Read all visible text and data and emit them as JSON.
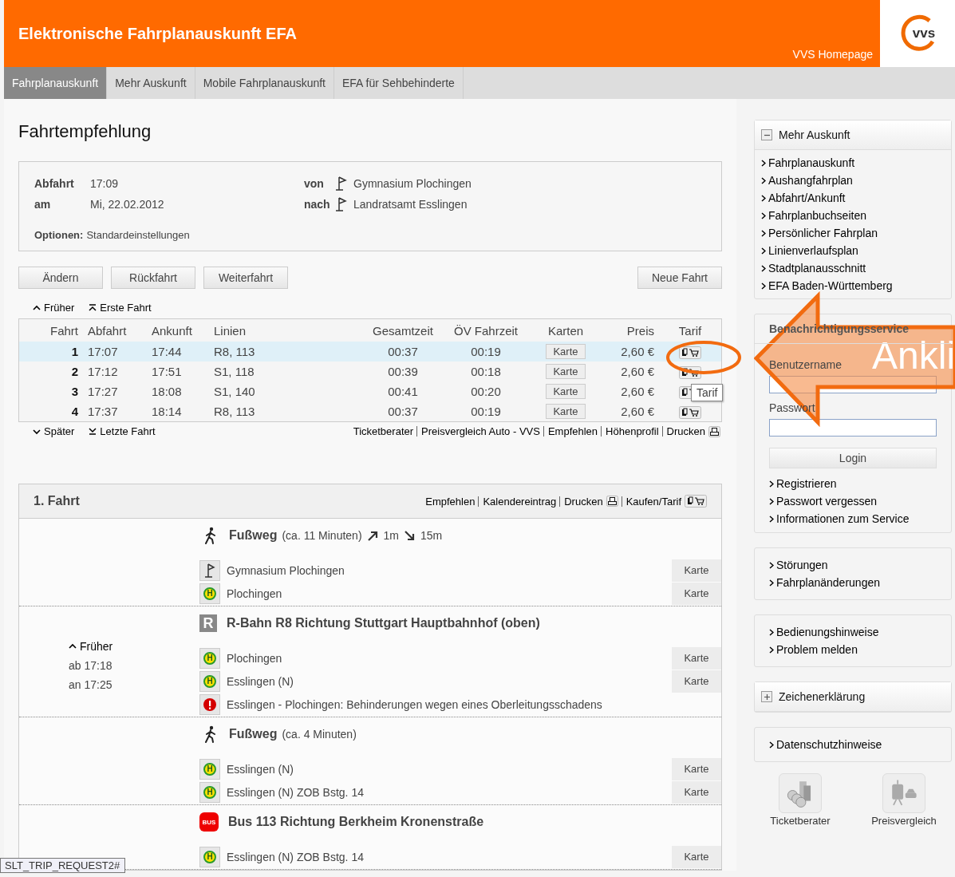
{
  "header": {
    "title": "Elektronische Fahrplanauskunft EFA",
    "link": "VVS Homepage",
    "logo": "vvs"
  },
  "nav": [
    {
      "label": "Fahrplanauskunft",
      "selected": true
    },
    {
      "label": "Mehr Auskunft",
      "selected": false
    },
    {
      "label": "Mobile Fahrplanauskunft",
      "selected": false
    },
    {
      "label": "EFA für Sehbehinderte",
      "selected": false
    }
  ],
  "page_title": "Fahrtempfehlung",
  "summary": {
    "times": [
      {
        "label": "Abfahrt",
        "value": "17:09"
      },
      {
        "label": "am",
        "value": "Mi, 22.02.2012"
      }
    ],
    "stops": [
      {
        "label": "von",
        "value": "Gymnasium Plochingen"
      },
      {
        "label": "nach",
        "value": "Landratsamt Esslingen"
      }
    ],
    "options_label": "Optionen:",
    "options_value": "Standardeinstellungen"
  },
  "actions": [
    "Ändern",
    "Rückfahrt",
    "Weiterfahrt"
  ],
  "new_trip": "Neue Fahrt",
  "earlier": [
    {
      "kind": "step",
      "label": "Früher"
    },
    {
      "kind": "jump",
      "label": "Erste Fahrt"
    }
  ],
  "results": {
    "columns": [
      "Fahrt",
      "Abfahrt",
      "Ankunft",
      "Linien",
      "Gesamtzeit",
      "ÖV Fahrzeit",
      "Karten",
      "Preis",
      "Tarif"
    ],
    "rows": [
      {
        "num": "1",
        "dep": "17:07",
        "arr": "17:44",
        "lines": "R8, 113",
        "total": "00:37",
        "pt": "00:19",
        "map": "Karte",
        "price": "2,60 €",
        "selected": true
      },
      {
        "num": "2",
        "dep": "17:12",
        "arr": "17:51",
        "lines": "S1, 118",
        "total": "00:39",
        "pt": "00:18",
        "map": "Karte",
        "price": "2,60 €",
        "selected": false
      },
      {
        "num": "3",
        "dep": "17:27",
        "arr": "18:08",
        "lines": "S1, 140",
        "total": "00:41",
        "pt": "00:20",
        "map": "Karte",
        "price": "2,60 €",
        "selected": false
      },
      {
        "num": "4",
        "dep": "17:37",
        "arr": "18:14",
        "lines": "R8, 113",
        "total": "00:37",
        "pt": "00:19",
        "map": "Karte",
        "price": "2,60 €",
        "selected": false
      }
    ]
  },
  "later": [
    {
      "kind": "step",
      "label": "Später"
    },
    {
      "kind": "jump",
      "label": "Letzte Fahrt"
    }
  ],
  "footer_links": [
    {
      "kind": "text",
      "label": "Ticketberater"
    },
    {
      "kind": "text",
      "label": "Preisvergleich Auto - VVS"
    },
    {
      "kind": "text",
      "label": "Empfehlen"
    },
    {
      "kind": "text",
      "label": "Höhenprofil"
    },
    {
      "kind": "print",
      "label": "Drucken"
    }
  ],
  "trip": {
    "title": "1. Fahrt",
    "links": [
      {
        "kind": "text",
        "label": "Empfehlen"
      },
      {
        "kind": "text",
        "label": "Kalendereintrag"
      },
      {
        "kind": "print",
        "label": "Drucken"
      },
      {
        "kind": "ticket",
        "label": "Kaufen/Tarif"
      }
    ],
    "legs": [
      {
        "kind": "walk",
        "title": "Fußweg",
        "note": "(ca. 11 Minuten)",
        "up": "1m",
        "down": "15m",
        "stops": [
          {
            "kind": "flag",
            "name": "Gymnasium Plochingen",
            "map": "Karte"
          },
          {
            "kind": "stop",
            "symbol": "H",
            "name": "Plochingen",
            "map": "Karte"
          }
        ]
      },
      {
        "kind": "rail",
        "badge": "R",
        "title": "R-Bahn R8 Richtung Stuttgart Hauptbahnhof (oben)",
        "earlier": "Früher",
        "times": [
          "ab 17:18",
          "an 17:25"
        ],
        "stops": [
          {
            "kind": "stop",
            "symbol": "H",
            "name": "Plochingen",
            "map": "Karte"
          },
          {
            "kind": "stop",
            "symbol": "H",
            "name": "Esslingen (N)",
            "map": "Karte"
          },
          {
            "kind": "alert",
            "name": "Esslingen - Plochingen: Behinderungen wegen eines Oberleitungsschadens"
          }
        ]
      },
      {
        "kind": "walk",
        "title": "Fußweg",
        "note": "(ca. 4 Minuten)",
        "stops": [
          {
            "kind": "stop",
            "symbol": "H",
            "name": "Esslingen (N)",
            "map": "Karte"
          },
          {
            "kind": "stop",
            "symbol": "H",
            "name": "Esslingen (N) ZOB Bstg. 14",
            "map": "Karte"
          }
        ]
      },
      {
        "kind": "bus",
        "badge": "BUS",
        "title": "Bus 113 Richtung Berkheim Kronenstraße",
        "stops": [
          {
            "kind": "stop",
            "symbol": "H",
            "name": "Esslingen (N) ZOB Bstg. 14",
            "map": "Karte"
          }
        ]
      }
    ]
  },
  "sidebar": [
    {
      "kind": "menu",
      "title": "Mehr Auskunft",
      "expanded": true,
      "items": [
        "Fahrplanauskunft",
        "Aushangfahrplan",
        "Abfahrt/Ankunft",
        "Fahrplanbuchseiten",
        "Persönlicher Fahrplan",
        "Linienverlaufsplan",
        "Stadtplanausschnitt",
        "EFA Baden-Württemberg"
      ]
    },
    {
      "kind": "login",
      "title": "Benachrichtigungsservice",
      "fields": [
        "Benutzername",
        "Passwort"
      ],
      "button": "Login",
      "items": [
        "Registrieren",
        "Passwort vergessen",
        "Informationen zum Service"
      ]
    },
    {
      "kind": "links",
      "items": [
        "Störungen",
        "Fahrplanänderungen"
      ]
    },
    {
      "kind": "links",
      "items": [
        "Bedienungshinweise",
        "Problem melden"
      ]
    },
    {
      "kind": "menu",
      "title": "Zeichenerklärung",
      "expanded": false
    },
    {
      "kind": "links",
      "items": [
        "Datenschutzhinweise"
      ]
    }
  ],
  "tiles": [
    {
      "kind": "coins",
      "label": "Ticketberater"
    },
    {
      "kind": "compare",
      "label": "Preisvergleich"
    }
  ],
  "tooltip": "Tarif",
  "status_text": "SLT_TRIP_REQUEST2#",
  "annotation": {
    "text": "Ankli"
  }
}
